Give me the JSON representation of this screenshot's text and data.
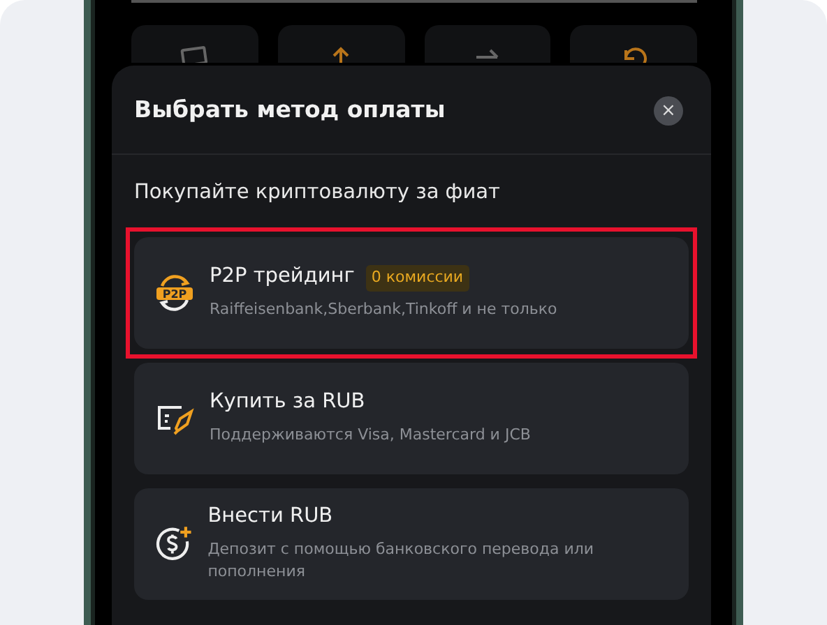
{
  "background_tiles": [
    {
      "kind": "card"
    },
    {
      "kind": "up"
    },
    {
      "kind": "transfer"
    },
    {
      "kind": "history"
    }
  ],
  "sheet": {
    "title": "Выбрать метод оплаты",
    "close_icon": "×",
    "section_title": "Покупайте криптовалюту за фиат",
    "methods": [
      {
        "kind": "p2p",
        "icon_text": "P2P",
        "title": "P2P трейдинг",
        "badge": "0 комиссии",
        "subtitle": "Raiffeisenbank,Sberbank,Tinkoff и не только",
        "highlighted": true
      },
      {
        "kind": "card",
        "title": "Купить за RUB",
        "subtitle": "Поддерживаются Visa, Mastercard и JCB",
        "highlighted": false
      },
      {
        "kind": "deposit",
        "title": "Внести RUB",
        "subtitle": "Депозит с помощью банковского перевода или пополнения",
        "highlighted": false
      }
    ]
  }
}
